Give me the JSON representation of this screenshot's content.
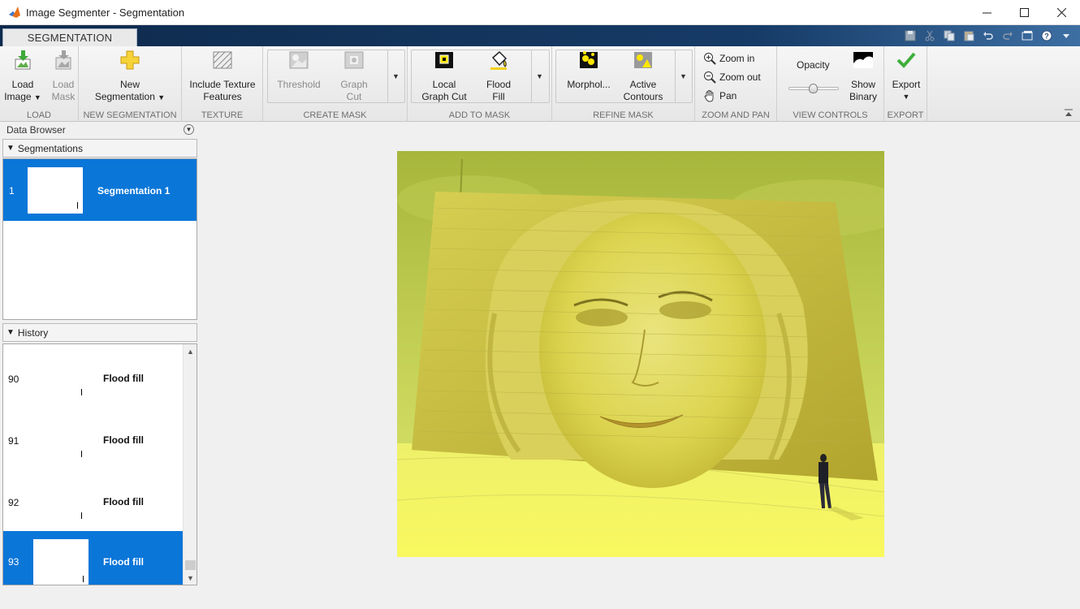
{
  "window": {
    "title": "Image Segmenter - Segmentation",
    "controls": [
      "minimize",
      "maximize",
      "close"
    ]
  },
  "tabs": [
    {
      "label": "SEGMENTATION",
      "active": true
    }
  ],
  "quick_access": [
    "save-icon",
    "cut-icon",
    "copy-icon",
    "paste-icon",
    "undo-icon",
    "redo-icon",
    "window-icon",
    "help-icon",
    "dropdown-icon"
  ],
  "ribbon": {
    "load": {
      "label": "LOAD",
      "load_image": {
        "line1": "Load",
        "line2": "Image"
      },
      "load_mask": {
        "line1": "Load",
        "line2": "Mask"
      }
    },
    "new_segmentation": {
      "label": "NEW SEGMENTATION",
      "button": {
        "line1": "New",
        "line2": "Segmentation"
      }
    },
    "texture": {
      "label": "TEXTURE",
      "button": {
        "line1": "Include Texture",
        "line2": "Features"
      }
    },
    "create_mask": {
      "label": "CREATE MASK",
      "threshold": "Threshold",
      "graph_cut": {
        "line1": "Graph",
        "line2": "Cut"
      }
    },
    "add_to_mask": {
      "label": "ADD TO MASK",
      "local_graph_cut": {
        "line1": "Local",
        "line2": "Graph Cut"
      },
      "flood_fill": {
        "line1": "Flood",
        "line2": "Fill"
      }
    },
    "refine_mask": {
      "label": "REFINE MASK",
      "morphology": "Morphol...",
      "active_contours": {
        "line1": "Active",
        "line2": "Contours"
      }
    },
    "zoom_and_pan": {
      "label": "ZOOM AND PAN",
      "zoom_in": "Zoom in",
      "zoom_out": "Zoom out",
      "pan": "Pan"
    },
    "view_controls": {
      "label": "VIEW CONTROLS",
      "opacity": "Opacity",
      "opacity_value": 0.5,
      "show_binary": {
        "line1": "Show",
        "line2": "Binary"
      }
    },
    "export": {
      "label": "EXPORT",
      "button": "Export"
    }
  },
  "data_browser": {
    "title": "Data Browser",
    "segmentations_header": "Segmentations",
    "segmentations": [
      {
        "num": "1",
        "name": "Segmentation 1",
        "selected": true
      }
    ],
    "history_header": "History",
    "history": [
      {
        "num": "90",
        "name": "Flood fill",
        "selected": false
      },
      {
        "num": "91",
        "name": "Flood fill",
        "selected": false
      },
      {
        "num": "92",
        "name": "Flood fill",
        "selected": false
      },
      {
        "num": "93",
        "name": "Flood fill",
        "selected": true
      }
    ]
  },
  "colors": {
    "accent": "#0a76d8",
    "mask_overlay": "#f5f04a",
    "tabstrip": "#163b67"
  }
}
